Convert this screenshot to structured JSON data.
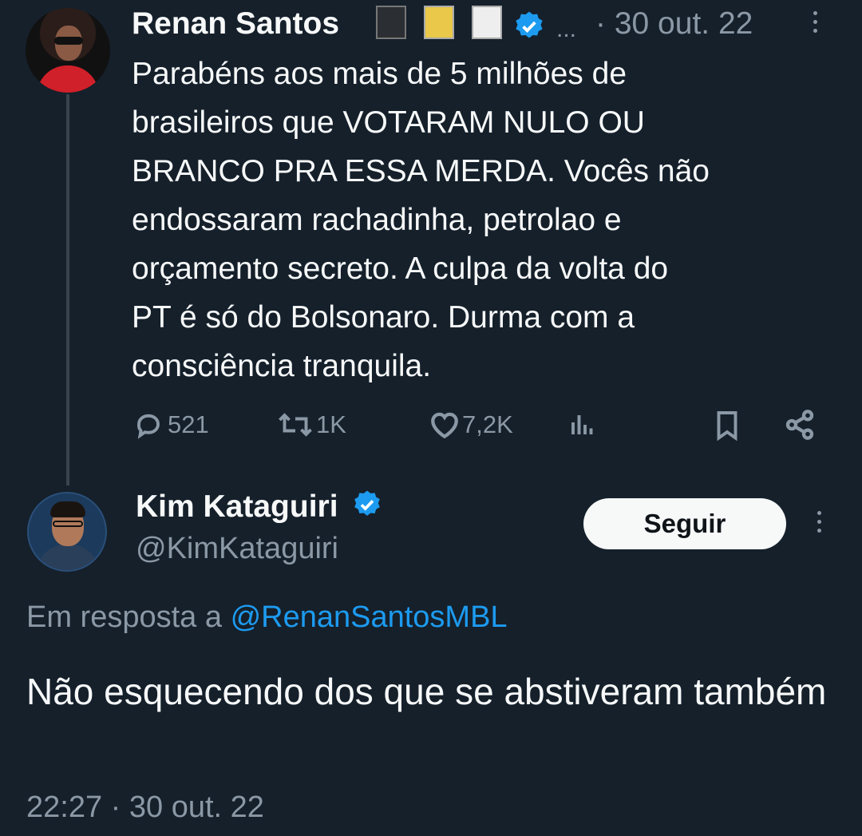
{
  "original_tweet": {
    "author_name": "Renan Santos",
    "more_indicator": "...",
    "date_separator": "·",
    "date": "30 out. 22",
    "text": "Parabéns aos mais de 5 milhões de\nbrasileiros que VOTARAM NULO OU\nBRANCO PRA ESSA MERDA. Vocês não\nendossaram rachadinha, petrolao e\norçamento secreto. A culpa da volta do\nPT é só do Bolsonaro. Durma com a\nconsciência tranquila.",
    "actions": {
      "replies": "521",
      "retweets": "1K",
      "likes": "7,2K"
    },
    "colors": {
      "verified": "#1d9bf0",
      "avatar_shirt": "#d0202a"
    }
  },
  "reply_tweet": {
    "author_name": "Kim Kataguiri",
    "handle": "@KimKataguiri",
    "follow_label": "Seguir",
    "reply_prefix": "Em resposta a",
    "reply_mention": "@RenanSantosMBL",
    "text": "Não esquecendo dos que se abstiveram também",
    "time": "22:27",
    "time_separator": "·",
    "date": "30 out. 22"
  },
  "theme": {
    "background": "#15202b",
    "text": "#f7f9f9",
    "muted": "#8b98a5",
    "accent": "#1d9bf0"
  }
}
